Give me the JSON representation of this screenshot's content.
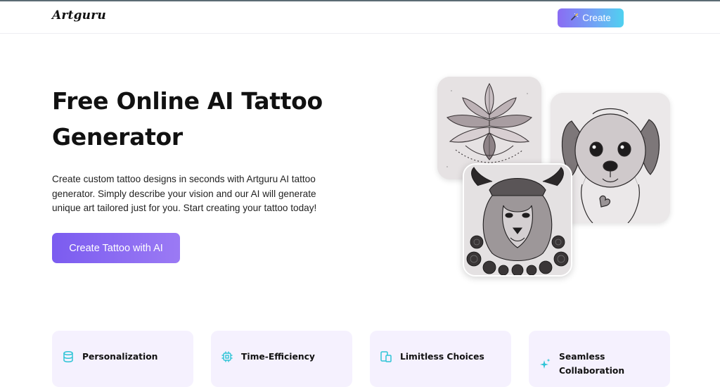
{
  "header": {
    "logo": "Artguru",
    "create_button_label": "Create",
    "create_button_icon": "magic-wand-icon"
  },
  "hero": {
    "title": "Free Online AI Tattoo Generator",
    "description": "Create custom tattoo designs in seconds with Artguru AI tattoo generator. Simply describe your vision and our AI will generate unique art tailored just for you. Start creating your tattoo today!",
    "cta_label": "Create Tattoo with AI",
    "images": [
      "lotus-tattoo-image",
      "puppy-tattoo-image",
      "lion-tattoo-image"
    ]
  },
  "features": [
    {
      "icon": "database-icon",
      "label": "Personalization"
    },
    {
      "icon": "chip-icon",
      "label": "Time-Efficiency"
    },
    {
      "icon": "devices-icon",
      "label": "Limitless Choices"
    },
    {
      "icon": "sparkle-icon",
      "label": "Seamless Collaboration"
    }
  ],
  "colors": {
    "accent": "#7b5cf0",
    "icon_teal": "#2ec4d6",
    "card_bg": "#f5f1fe"
  }
}
